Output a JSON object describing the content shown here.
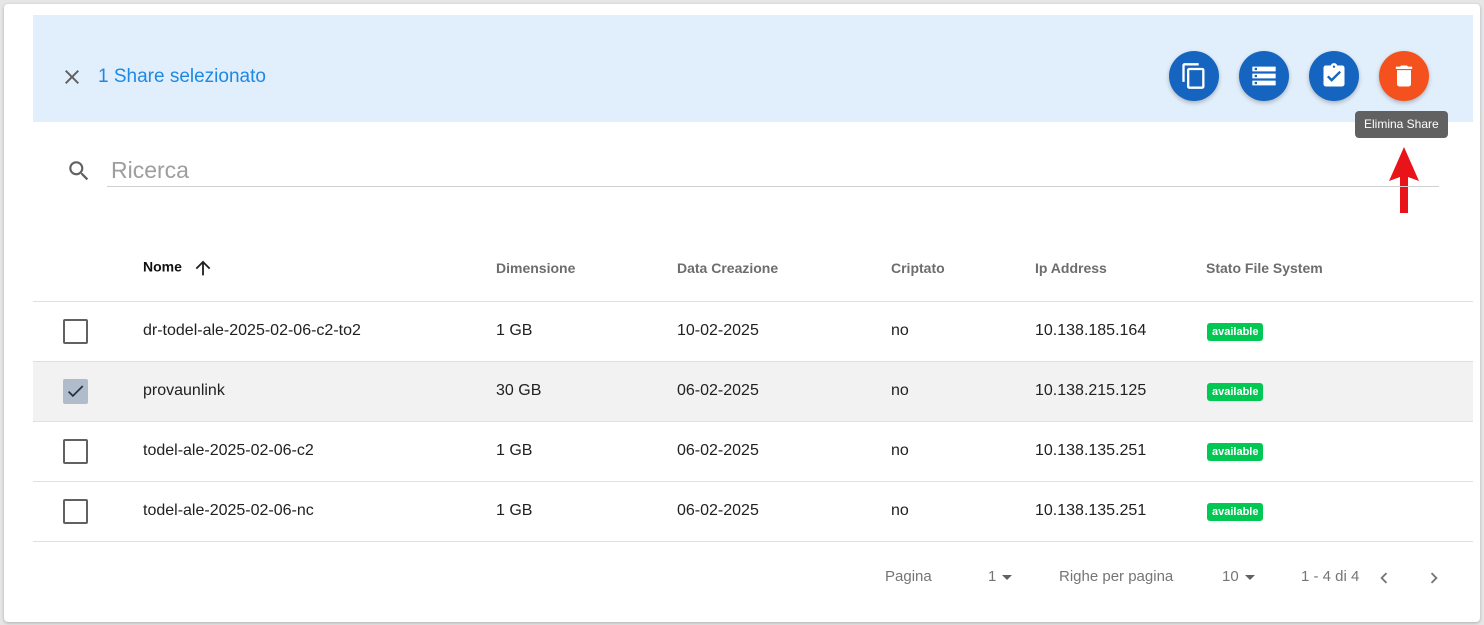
{
  "selection": {
    "text": "1 Share selezionato",
    "actions": [
      {
        "name": "copy",
        "icon": "copy-icon",
        "color": "#1565c0"
      },
      {
        "name": "storage",
        "icon": "storage-icon",
        "color": "#1565c0"
      },
      {
        "name": "assignment-check",
        "icon": "clipboard-check-icon",
        "color": "#1565c0"
      },
      {
        "name": "delete",
        "icon": "delete-icon",
        "color": "#f4511e"
      }
    ],
    "tooltip": "Elimina Share"
  },
  "search": {
    "placeholder": "Ricerca",
    "value": ""
  },
  "table": {
    "columns": [
      "Nome",
      "Dimensione",
      "Data Creazione",
      "Criptato",
      "Ip Address",
      "Stato File System"
    ],
    "sorted_column": "Nome",
    "sort_direction": "asc",
    "rows": [
      {
        "selected": false,
        "name": "dr-todel-ale-2025-02-06-c2-to2",
        "size": "1 GB",
        "created": "10-02-2025",
        "encrypted": "no",
        "ip": "10.138.185.164",
        "status": "available"
      },
      {
        "selected": true,
        "name": "provaunlink",
        "size": "30 GB",
        "created": "06-02-2025",
        "encrypted": "no",
        "ip": "10.138.215.125",
        "status": "available"
      },
      {
        "selected": false,
        "name": "todel-ale-2025-02-06-c2",
        "size": "1 GB",
        "created": "06-02-2025",
        "encrypted": "no",
        "ip": "10.138.135.251",
        "status": "available"
      },
      {
        "selected": false,
        "name": "todel-ale-2025-02-06-nc",
        "size": "1 GB",
        "created": "06-02-2025",
        "encrypted": "no",
        "ip": "10.138.135.251",
        "status": "available"
      }
    ]
  },
  "pagination": {
    "page_label": "Pagina",
    "page_value": "1",
    "rows_label": "Righe per pagina",
    "rows_value": "10",
    "range_text": "1 - 4 di 4"
  },
  "colors": {
    "accent": "#1e88e5",
    "fab_blue": "#1565c0",
    "fab_orange": "#f4511e",
    "badge_green": "#00c853",
    "selection_bar": "#e1eefb",
    "annotation_arrow": "#e8141a"
  }
}
